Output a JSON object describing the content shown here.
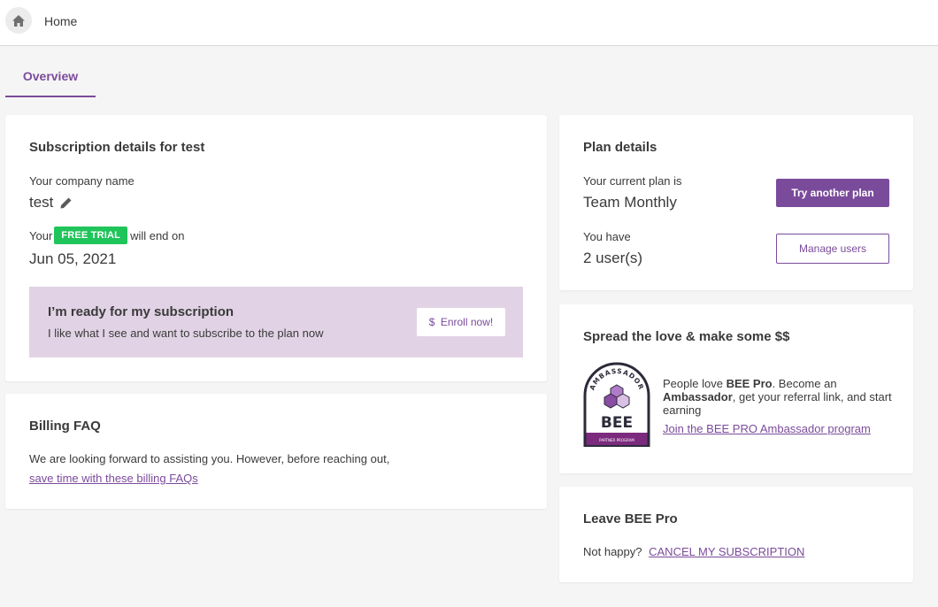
{
  "header": {
    "home_icon": "home-icon",
    "breadcrumb": "Home"
  },
  "tabs": [
    {
      "label": "Overview",
      "active": true
    }
  ],
  "subscription": {
    "title": "Subscription details for test",
    "company_label": "Your company name",
    "company_value": "test",
    "trial_prefix": "Your",
    "trial_badge": "FREE TRIAL",
    "trial_suffix": "will end on",
    "trial_end": "Jun 05, 2021",
    "enroll": {
      "title": "I’m ready for my subscription",
      "description": "I like what I see and want to subscribe to the plan now",
      "button_icon": "$",
      "button_label": "Enroll now!"
    }
  },
  "billing_faq": {
    "title": "Billing FAQ",
    "text": "We are looking forward to assisting you. However, before reaching out,",
    "link": "save time with these billing FAQs"
  },
  "plan": {
    "title": "Plan details",
    "current_label": "Your current plan is",
    "current_value": "Team Monthly",
    "try_button": "Try another plan",
    "users_label": "You have",
    "users_value": "2 user(s)",
    "manage_button": "Manage users"
  },
  "ambassador": {
    "title": "Spread the love & make some $$",
    "badge_arc": "AMBASSADOR",
    "badge_name": "BEE",
    "badge_footer": "PARTNER PROGRAM",
    "text_1": "People love ",
    "text_brand": "BEE Pro",
    "text_2": ". Become an ",
    "text_role": "Ambassador",
    "text_3": ", get your referral link, and start earning",
    "link": "Join the BEE PRO Ambassador program"
  },
  "leave": {
    "title": "Leave BEE Pro",
    "prompt": "Not happy?",
    "link": "CANCEL MY SUBSCRIPTION"
  },
  "colors": {
    "accent": "#7b4b9b",
    "trial_green": "#1fc45a",
    "enroll_bg": "#e1d3e5",
    "page_bg": "#f5f5f5"
  }
}
